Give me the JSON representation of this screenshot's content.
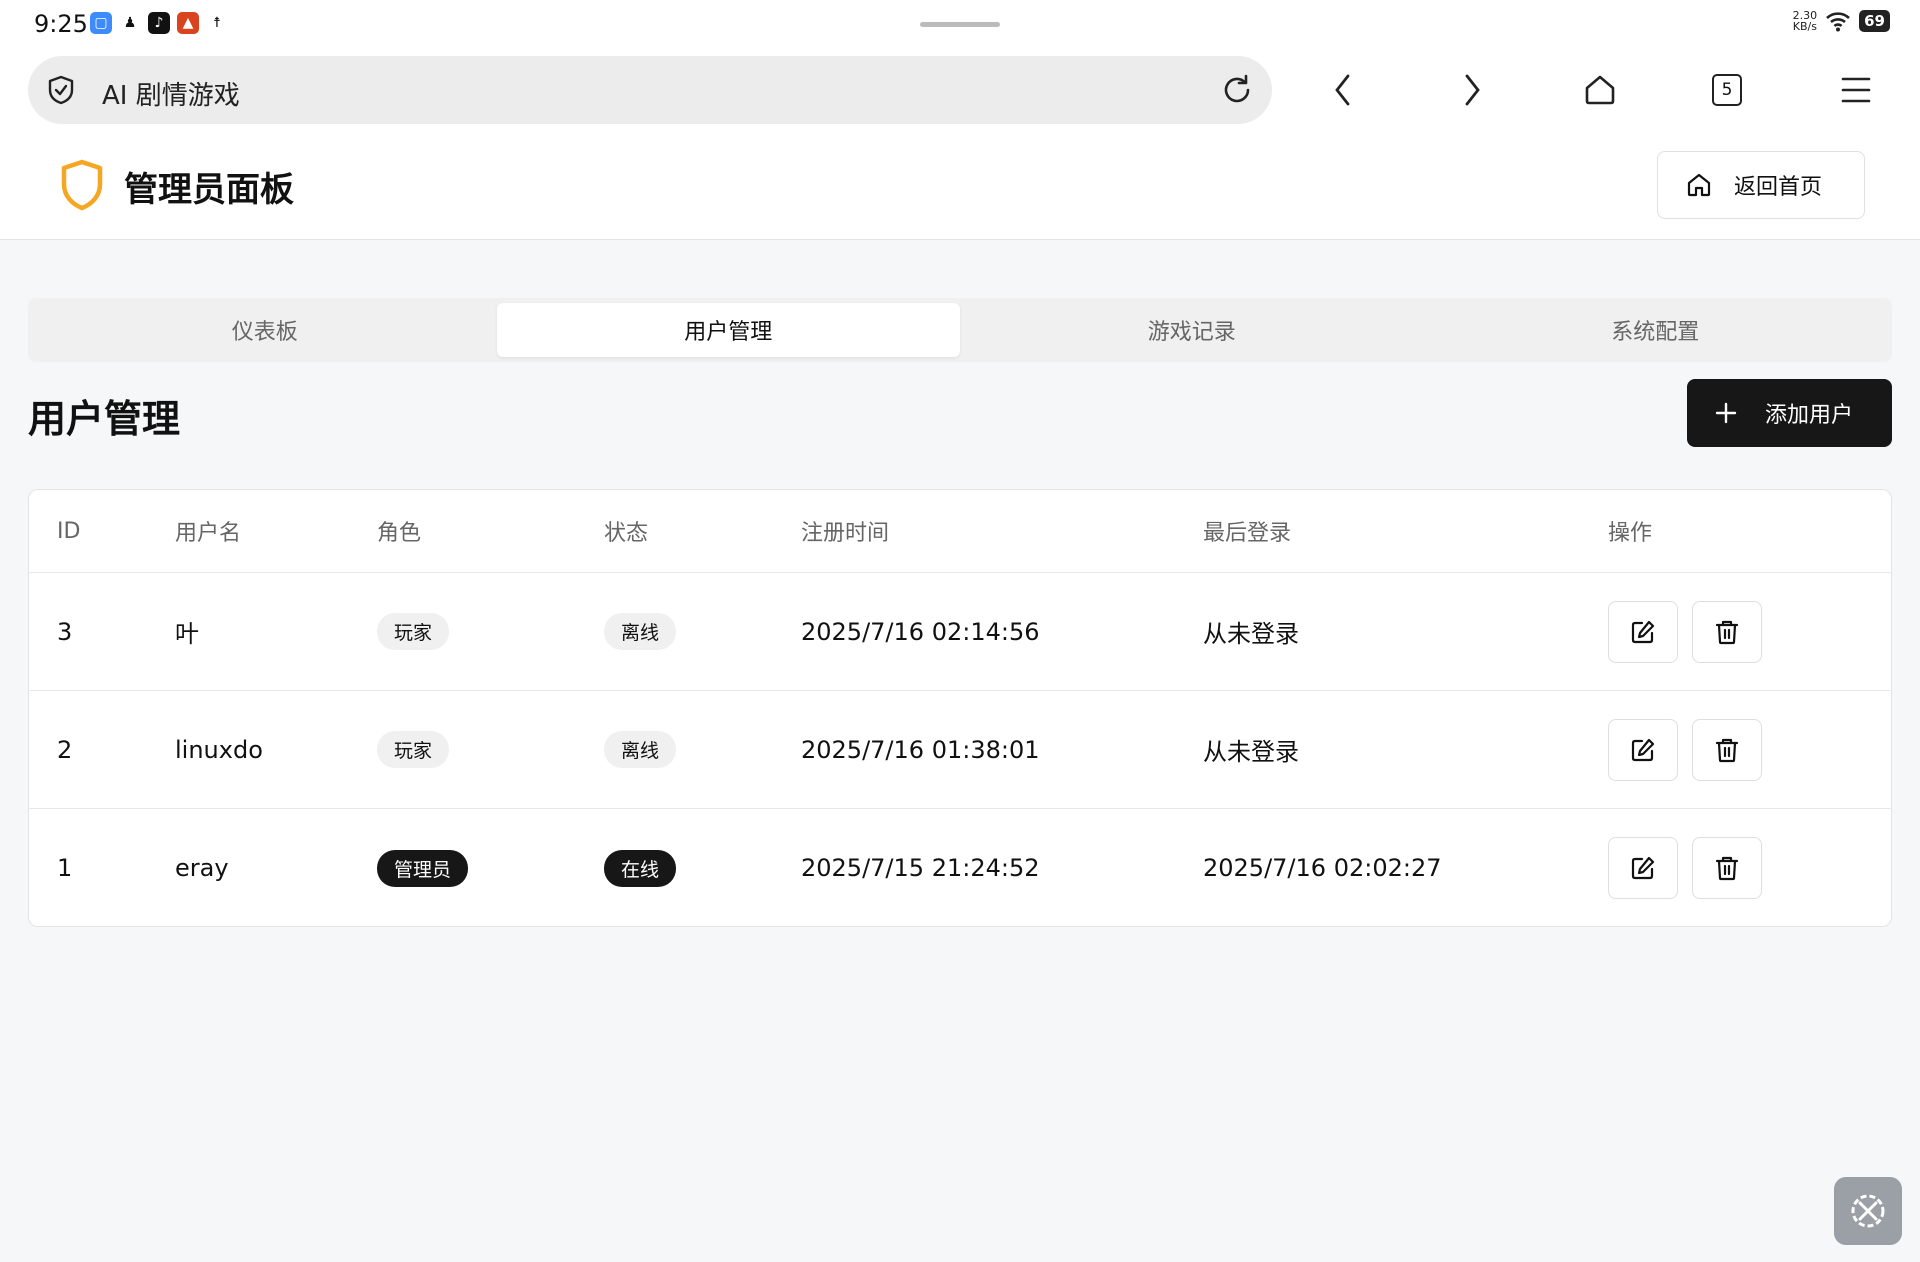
{
  "status_bar": {
    "time": "9:25",
    "net_speed_value": "2.30",
    "net_speed_unit": "KB/s",
    "battery": "69",
    "app_icons": [
      "messages-icon",
      "qq-icon",
      "tiktok-icon",
      "app-icon",
      "accessibility-icon"
    ]
  },
  "browser": {
    "url_text": "AI 剧情游戏",
    "tab_count": "5"
  },
  "header": {
    "title": "管理员面板",
    "home_button": "返回首页",
    "accent_color": "#f5a623"
  },
  "tabs": [
    {
      "label": "仪表板",
      "active": false
    },
    {
      "label": "用户管理",
      "active": true
    },
    {
      "label": "游戏记录",
      "active": false
    },
    {
      "label": "系统配置",
      "active": false
    }
  ],
  "section": {
    "title": "用户管理",
    "add_button": "添加用户"
  },
  "table": {
    "columns": [
      "ID",
      "用户名",
      "角色",
      "状态",
      "注册时间",
      "最后登录",
      "操作"
    ],
    "rows": [
      {
        "id": "3",
        "username": "叶",
        "role": "玩家",
        "status": "离线",
        "registered": "2025/7/16 02:14:56",
        "last_login": "从未登录"
      },
      {
        "id": "2",
        "username": "linuxdo",
        "role": "玩家",
        "status": "离线",
        "registered": "2025/7/16 01:38:01",
        "last_login": "从未登录"
      },
      {
        "id": "1",
        "username": "eray",
        "role": "管理员",
        "status": "在线",
        "registered": "2025/7/15 21:24:52",
        "last_login": "2025/7/16 02:02:27"
      }
    ]
  }
}
